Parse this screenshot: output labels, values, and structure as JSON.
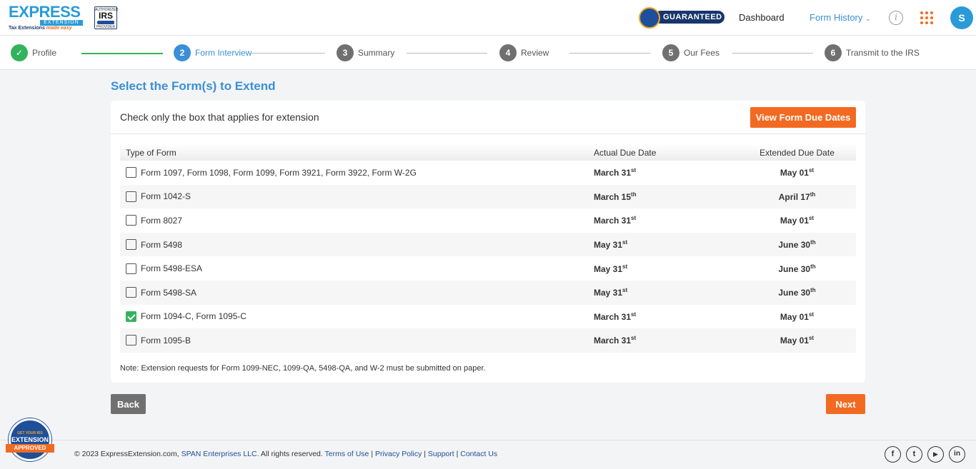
{
  "header": {
    "logo_text_1": "EXPRESS",
    "logo_bar": "EXTENSION",
    "logo_tag": "Tax Extensions",
    "logo_tag_script": "made easy",
    "irs_top": "AUTHORIZED",
    "irs_main": "IRS",
    "irs_bottom": "PROVIDER",
    "guaranteed": "GUARANTEED",
    "dashboard": "Dashboard",
    "form_history": "Form History",
    "avatar": "S"
  },
  "stepper": [
    {
      "num": "",
      "label": "Profile"
    },
    {
      "num": "2",
      "label": "Form Interview"
    },
    {
      "num": "3",
      "label": "Summary"
    },
    {
      "num": "4",
      "label": "Review"
    },
    {
      "num": "5",
      "label": "Our Fees"
    },
    {
      "num": "6",
      "label": "Transmit to the IRS"
    }
  ],
  "main": {
    "title": "Select the Form(s) to Extend",
    "instruction": "Check only the box that applies for extension",
    "view_due_dates": "View Form Due Dates",
    "columns": [
      "Type of Form",
      "Actual Due Date",
      "Extended Due Date"
    ],
    "rows": [
      {
        "form": "Form 1097, Form 1098, Form 1099, Form 3921, Form 3922, Form W-2G",
        "actual": "March 31",
        "actual_sup": "st",
        "extended": "May 01",
        "extended_sup": "st",
        "checked": false
      },
      {
        "form": "Form 1042-S",
        "actual": "March 15",
        "actual_sup": "th",
        "extended": "April 17",
        "extended_sup": "th",
        "checked": false
      },
      {
        "form": "Form 8027",
        "actual": "March 31",
        "actual_sup": "st",
        "extended": "May 01",
        "extended_sup": "st",
        "checked": false
      },
      {
        "form": "Form 5498",
        "actual": "May 31",
        "actual_sup": "st",
        "extended": "June 30",
        "extended_sup": "th",
        "checked": false
      },
      {
        "form": "Form 5498-ESA",
        "actual": "May 31",
        "actual_sup": "st",
        "extended": "June 30",
        "extended_sup": "th",
        "checked": false
      },
      {
        "form": "Form 5498-SA",
        "actual": "May 31",
        "actual_sup": "st",
        "extended": "June 30",
        "extended_sup": "th",
        "checked": false
      },
      {
        "form": "Form 1094-C, Form 1095-C",
        "actual": "March 31",
        "actual_sup": "st",
        "extended": "May 01",
        "extended_sup": "st",
        "checked": true
      },
      {
        "form": "Form 1095-B",
        "actual": "March 31",
        "actual_sup": "st",
        "extended": "May 01",
        "extended_sup": "st",
        "checked": false
      }
    ],
    "note": "Note: Extension requests for Form 1099-NEC, 1099-QA, 5498-QA, and W-2 must be submitted on paper.",
    "back": "Back",
    "next": "Next"
  },
  "footer": {
    "badge_top": "GET YOUR IRS",
    "badge_main": "EXTENSION",
    "badge_ribbon": "APPROVED",
    "copyright": "© 2023 ExpressExtension.com,",
    "company": "SPAN Enterprises LLC.",
    "rights": "All rights reserved.",
    "terms": "Terms of Use",
    "privacy": "Privacy Policy",
    "support": "Support",
    "contact": "Contact Us",
    "social": [
      "f",
      "t",
      "▶",
      "in"
    ]
  },
  "colors": {
    "brand_blue": "#3a8fd6",
    "accent_orange": "#f26a21",
    "done_green": "#34b25d",
    "navy": "#1e4f9a"
  }
}
